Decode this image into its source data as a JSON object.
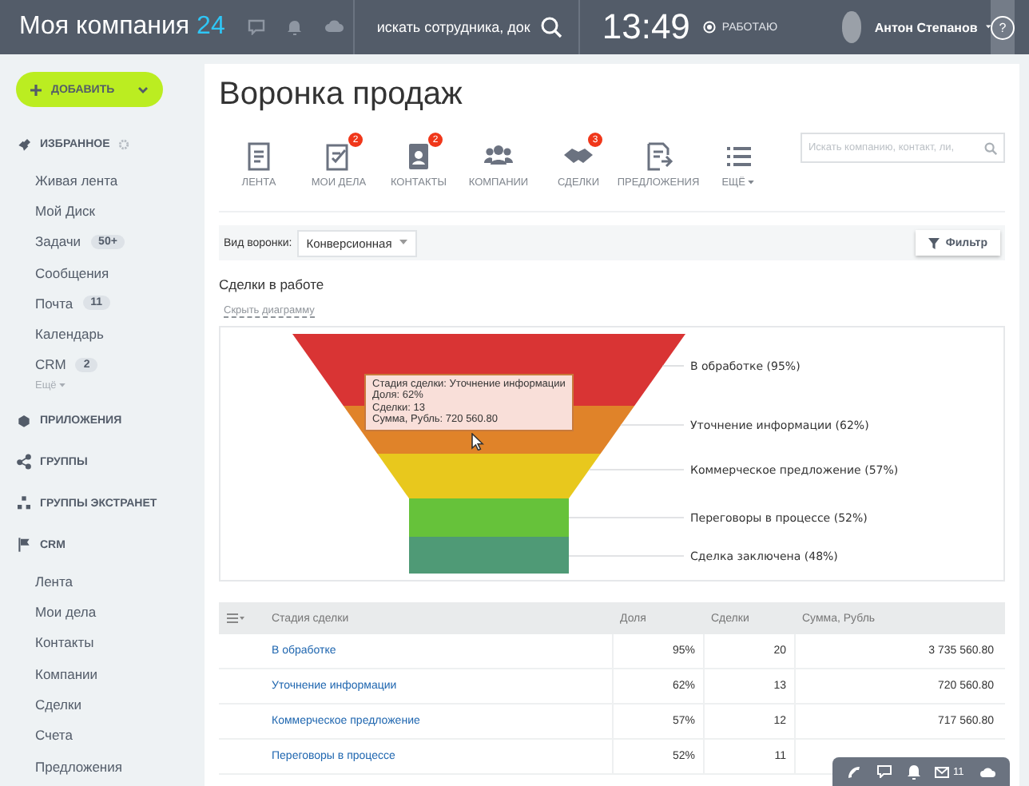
{
  "top_bar": {
    "logo": "Моя компания",
    "logo_number": "24",
    "search_placeholder": "искать сотрудника, док",
    "time": "13:49",
    "status": "РАБОТАЮ",
    "user_name": "Антон Степанов",
    "help": "?"
  },
  "add_button": "ДОБАВИТЬ",
  "sidebar": {
    "sections": [
      {
        "title": "ИЗБРАННОЕ",
        "items": [
          {
            "label": "Живая лента"
          },
          {
            "label": "Мой Диск"
          },
          {
            "label": "Задачи",
            "badge": "50+"
          },
          {
            "label": "Сообщения"
          },
          {
            "label": "Почта",
            "badge": "11"
          },
          {
            "label": "Календарь"
          },
          {
            "label": "CRM",
            "badge": "2"
          }
        ],
        "more": "Ещё"
      },
      {
        "title": "ПРИЛОЖЕНИЯ"
      },
      {
        "title": "ГРУППЫ"
      },
      {
        "title": "ГРУППЫ ЭКСТРАНЕТ"
      },
      {
        "title": "CRM",
        "items": [
          {
            "label": "Лента"
          },
          {
            "label": "Мои дела"
          },
          {
            "label": "Контакты"
          },
          {
            "label": "Компании"
          },
          {
            "label": "Сделки"
          },
          {
            "label": "Счета"
          },
          {
            "label": "Предложения"
          }
        ]
      }
    ]
  },
  "page_title": "Воронка продаж",
  "toolbar": {
    "items": [
      {
        "label": "ЛЕНТА"
      },
      {
        "label": "МОИ ДЕЛА",
        "badge": "2"
      },
      {
        "label": "КОНТАКТЫ",
        "badge": "2"
      },
      {
        "label": "КОМПАНИИ"
      },
      {
        "label": "СДЕЛКИ",
        "badge": "3"
      },
      {
        "label": "ПРЕДЛОЖЕНИЯ"
      },
      {
        "label": "ЕЩЁ"
      }
    ],
    "search_placeholder": "Искать компанию, контакт, ли,"
  },
  "filter_bar": {
    "label": "Вид воронки:",
    "select_value": "Конверсионная",
    "filter_button": "Фильтр"
  },
  "section_title": "Сделки в работе",
  "hide_chart_link": "Скрыть диаграмму",
  "funnel": {
    "stages": [
      {
        "label": "В обработке (95%)",
        "color": "#d93434"
      },
      {
        "label": "Уточнение информации (62%)",
        "color": "#e08329"
      },
      {
        "label": "Коммерческое предложение (57%)",
        "color": "#e8c81d"
      },
      {
        "label": "Переговоры в процессе (52%)",
        "color": "#66c23a"
      },
      {
        "label": "Сделка заключена (48%)",
        "color": "#4f9a76"
      }
    ],
    "tooltip": [
      "Стадия сделки: Уточнение информации",
      "Доля: 62%",
      "Сделки: 13",
      "Сумма, Рубль: 720 560.80"
    ]
  },
  "table": {
    "columns": [
      "Стадия сделки",
      "Доля",
      "Сделки",
      "Сумма, Рубль"
    ],
    "rows": [
      [
        "В обработке",
        "95%",
        "20",
        "3 735 560.80"
      ],
      [
        "Уточнение информации",
        "62%",
        "13",
        "720 560.80"
      ],
      [
        "Коммерческое предложение",
        "57%",
        "12",
        "717 560.80"
      ],
      [
        "Переговоры в процессе",
        "52%",
        "11",
        ""
      ]
    ]
  },
  "bottom_widget": {
    "mail_count": "11"
  }
}
